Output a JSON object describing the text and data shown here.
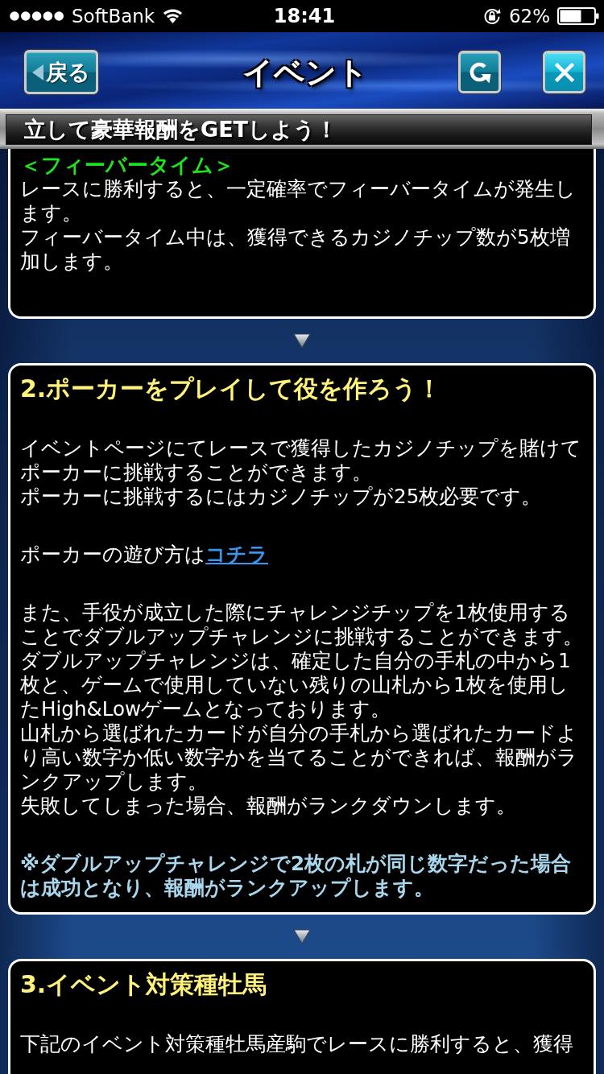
{
  "status_bar": {
    "carrier": "SoftBank",
    "time": "18:41",
    "battery": "62%"
  },
  "header": {
    "back_button": "戻る",
    "title": "イベント"
  },
  "banner": {
    "text": "立して豪華報酬をGETしよう！"
  },
  "sections": [
    {
      "blocks": [
        {
          "kind": "subheading",
          "text": "＜フィーバータイム＞"
        },
        {
          "kind": "paragraph",
          "sentences": [
            "レースに勝利すると、一定確率でフィーバータイムが発生します。",
            "フィーバータイム中は、獲得できるカジノチップ数が5枚増加します。"
          ]
        }
      ]
    },
    {
      "heading": "2.ポーカーをプレイして役を作ろう！",
      "blocks": [
        {
          "kind": "paragraph",
          "sentences": [
            "イベントページにてレースで獲得したカジノチップを賭けてポーカーに挑戦することができます。",
            "ポーカーに挑戦するにはカジノチップが25枚必要です。"
          ]
        },
        {
          "kind": "link_line",
          "text": "ポーカーの遊び方は",
          "link": "コチラ"
        },
        {
          "kind": "paragraph",
          "sentences": [
            "また、手役が成立した際にチャレンジチップを1枚使用することでダブルアップチャレンジに挑戦することができます。",
            "ダブルアップチャレンジは、確定した自分の手札の中から1枚と、ゲームで使用していない残りの山札から1枚を使用したHigh&Lowゲームとなっております。",
            "山札から選ばれたカードが自分の手札から選ばれたカードより高い数字か低い数字かを当てることができれば、報酬がランクアップします。",
            "失敗してしまった場合、報酬がランクダウンします。"
          ]
        },
        {
          "kind": "note",
          "text": "※ダブルアップチャレンジで2枚の札が同じ数字だった場合は成功となり、報酬がランクアップします。"
        }
      ]
    },
    {
      "heading": "3.イベント対策種牡馬",
      "blocks": [
        {
          "kind": "paragraph",
          "sentences": [
            "下記のイベント対策種牡馬産駒でレースに勝利すると、獲得"
          ]
        }
      ]
    }
  ]
}
